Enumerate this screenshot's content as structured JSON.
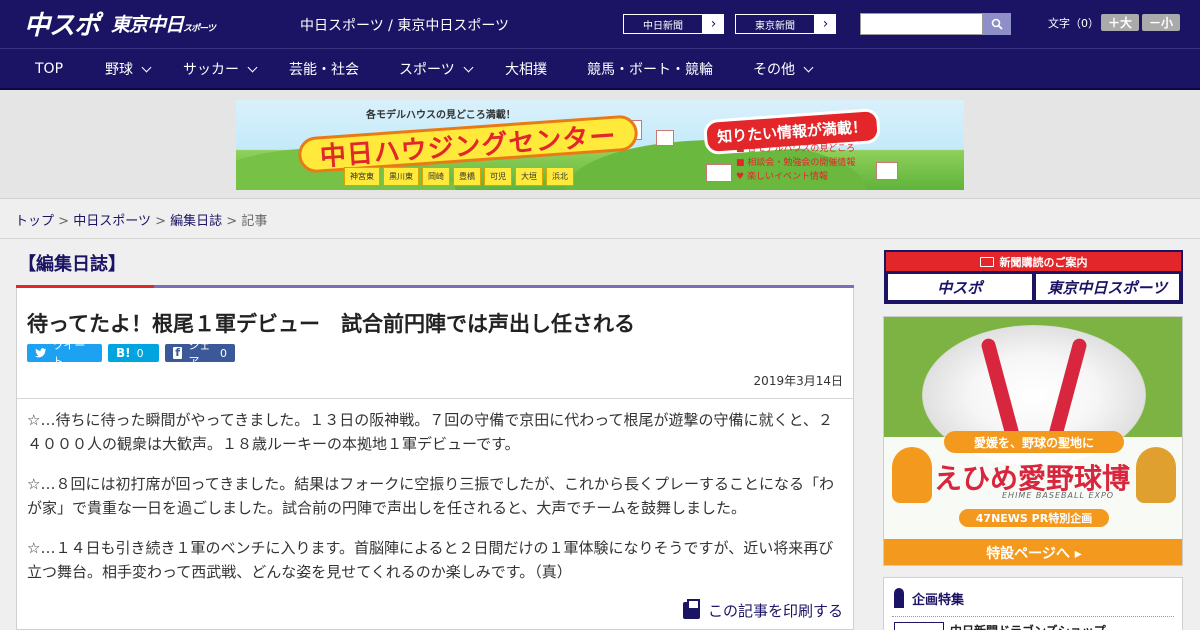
{
  "header": {
    "logo_main": "中スポ",
    "logo_sub": "東京中日",
    "logo_sub_small": "スポーツ",
    "site_link": "中日スポーツ / 東京中日スポーツ",
    "paper_links": [
      {
        "label": "中日新聞",
        "arrow": "›"
      },
      {
        "label": "東京新聞",
        "arrow": "›"
      }
    ],
    "search_placeholder": "",
    "font_size_label": "文字（0）",
    "font_bigger": "＋大",
    "font_smaller": "－小"
  },
  "nav": {
    "items": [
      {
        "label": "TOP",
        "has_menu": false
      },
      {
        "label": "野球",
        "has_menu": true
      },
      {
        "label": "サッカー",
        "has_menu": true
      },
      {
        "label": "芸能・社会",
        "has_menu": false
      },
      {
        "label": "スポーツ",
        "has_menu": true
      },
      {
        "label": "大相撲",
        "has_menu": false
      },
      {
        "label": "競馬・ボート・競輪",
        "has_menu": false
      },
      {
        "label": "その他",
        "has_menu": true
      }
    ]
  },
  "banner": {
    "top_text": "各モデルハウスの見どころ満載！",
    "title": "中日ハウジングセンター",
    "badge": "知りたい情報が満載！",
    "cities": [
      "神宮東",
      "黒川東",
      "岡崎",
      "豊橋",
      "可児",
      "大垣",
      "浜北"
    ],
    "bullets": [
      "各モデルハウスの見どころ",
      "相談会・勉強会の開催情報",
      "楽しいイベント情報"
    ]
  },
  "breadcrumb": {
    "items": [
      "トップ",
      "中日スポーツ",
      "編集日誌"
    ],
    "separator": ">",
    "current": "記事"
  },
  "section": {
    "title": "【編集日誌】"
  },
  "article": {
    "headline": "待ってたよ！根尾１軍デビュー　試合前円陣では声出し任される",
    "social": {
      "tweet": "ツイート",
      "hatena_icon": "B!",
      "hatena_count": "0",
      "share_icon": "f",
      "share": "シェア",
      "share_count": "0"
    },
    "date": "2019年3月14日",
    "paragraphs": [
      "☆…待ちに待った瞬間がやってきました。１３日の阪神戦。７回の守備で京田に代わって根尾が遊撃の守備に就くと、２４０００人の観衆は大歓声。１８歳ルーキーの本拠地１軍デビューです。",
      "☆…８回には初打席が回ってきました。結果はフォークに空振り三振でしたが、これから長くプレーすることになる「わが家」で貴重な一日を過ごしました。試合前の円陣で声出しを任されると、大声でチームを鼓舞しました。",
      "☆…１４日も引き続き１軍のベンチに入ります。首脳陣によると２日間だけの１軍体験になりそうですが、近い将来再び立つ舞台。相手変わって西武戦、どんな姿を見せてくれるのか楽しみです。（真）"
    ],
    "print_label": "この記事を印刷する"
  },
  "sidebar": {
    "subscribe_head": "新聞購読のご案内",
    "subscribe_options": [
      "中スポ",
      "東京中日スポーツ"
    ],
    "ad": {
      "tagline": "愛媛を、野球の聖地に",
      "title_prefix": "えひめ",
      "title_mid": "愛",
      "title_suffix": "野球博",
      "title_en": "EHIME BASEBALL EXPO",
      "pr": "47NEWS PR特別企画",
      "footer": "特設ページへ ▸"
    },
    "special_title": "企画特集",
    "special_item": "中日新聞ドラゴンズショップ"
  },
  "colors": {
    "brand_navy": "#1b1464",
    "accent_red": "#e2262a",
    "accent_purple": "#7a6fb6",
    "ad_orange": "#f39a1e",
    "twitter_blue": "#1da1f2",
    "hatena_blue": "#00a4de",
    "facebook_blue": "#3b5998"
  },
  "icons": {
    "search": "search-icon",
    "chevron": "chevron-down-icon",
    "print": "print-icon",
    "twitter": "twitter-icon",
    "hatena": "hatena-icon",
    "facebook": "facebook-icon",
    "subscribe": "newspaper-icon",
    "special": "ribbon-icon"
  }
}
